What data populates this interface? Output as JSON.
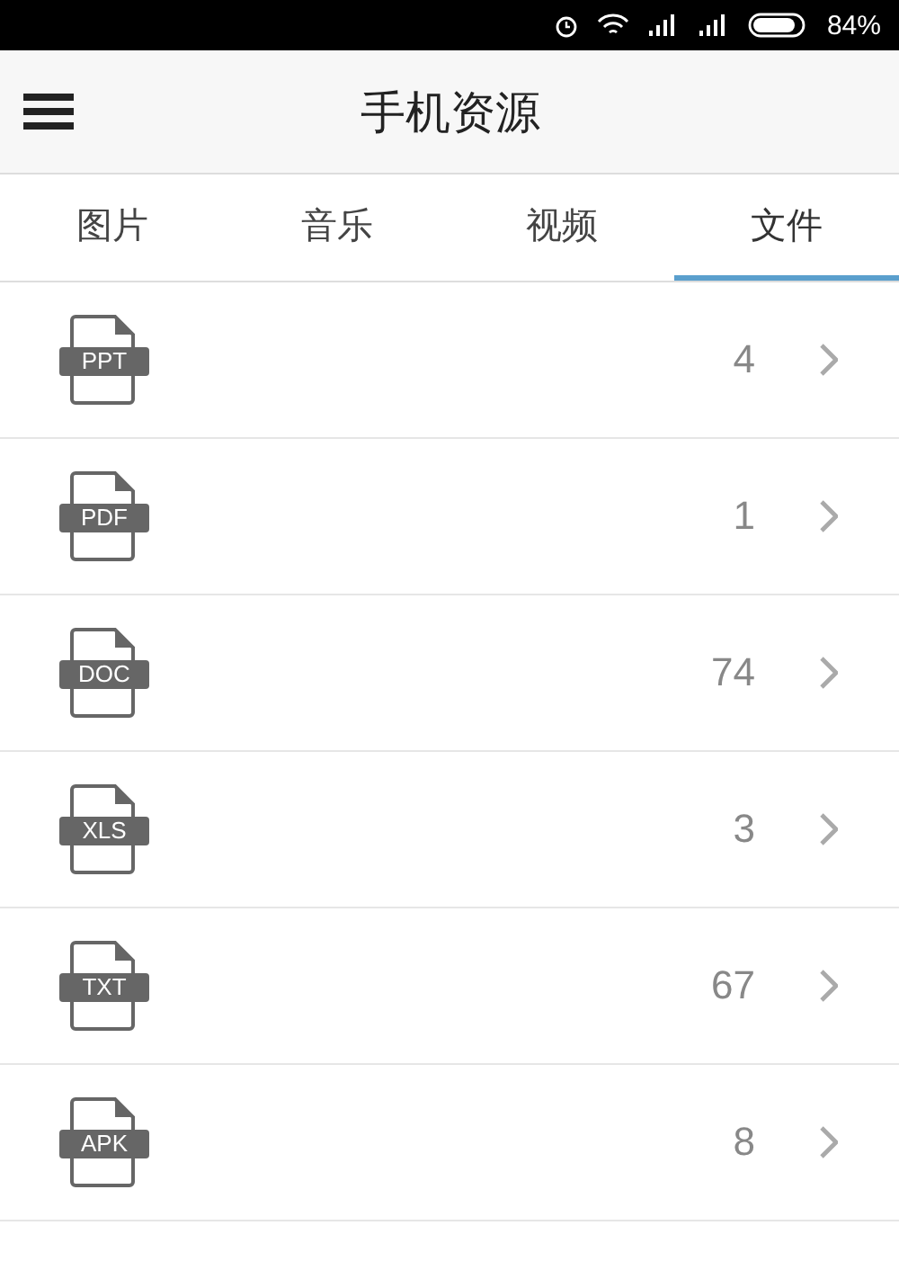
{
  "status_bar": {
    "battery": "84%"
  },
  "header": {
    "title": "手机资源"
  },
  "tabs": [
    {
      "label": "图片",
      "selected": false
    },
    {
      "label": "音乐",
      "selected": false
    },
    {
      "label": "视频",
      "selected": false
    },
    {
      "label": "文件",
      "selected": true
    }
  ],
  "files": [
    {
      "type": "PPT",
      "count": "4"
    },
    {
      "type": "PDF",
      "count": "1"
    },
    {
      "type": "DOC",
      "count": "74"
    },
    {
      "type": "XLS",
      "count": "3"
    },
    {
      "type": "TXT",
      "count": "67"
    },
    {
      "type": "APK",
      "count": "8"
    }
  ]
}
